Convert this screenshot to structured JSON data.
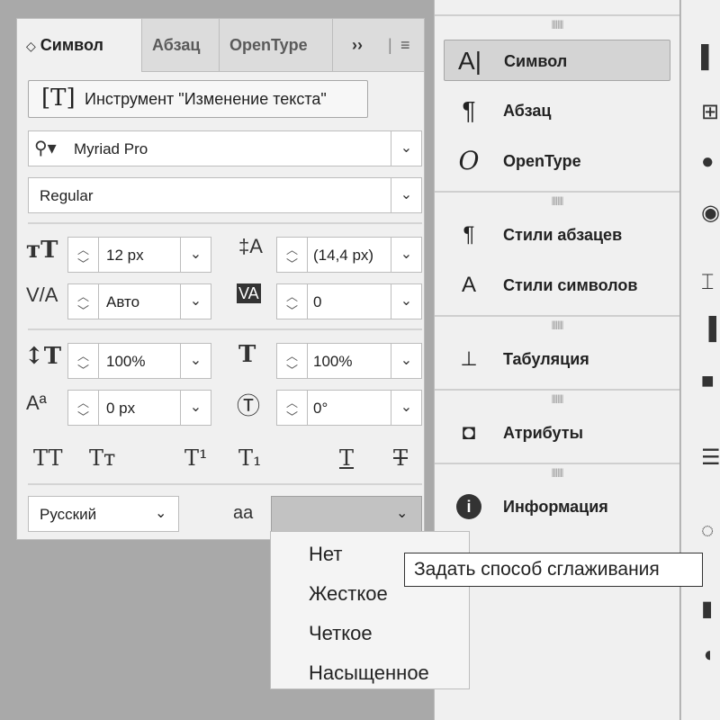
{
  "char_panel": {
    "tabs": [
      "Символ",
      "Абзац",
      "OpenType"
    ],
    "active_tab_marker": "◇",
    "more_icon": "››",
    "menu_icon": "≡",
    "tool_button_label": "Инструмент \"Изменение текста\"",
    "font_family": "Myriad Pro",
    "font_style": "Regular",
    "font_size": "12 px",
    "leading": "(14,4 px)",
    "kerning": "Авто",
    "tracking": "0",
    "vertical_scale": "100%",
    "horizontal_scale": "100%",
    "baseline_shift": "0 px",
    "rotation": "0°",
    "language": "Русский",
    "antialias_label": "aa",
    "caps_buttons": [
      "TT",
      "Tт",
      "T¹",
      "T₁",
      "T",
      "T"
    ]
  },
  "aa_menu": {
    "items": [
      "Нет",
      "Жесткое",
      "Четкое",
      "Насыщенное"
    ]
  },
  "tooltip": "Задать способ сглаживания",
  "panels": [
    {
      "label": "Символ",
      "icon": "A|"
    },
    {
      "label": "Абзац",
      "icon": "¶"
    },
    {
      "label": "OpenType",
      "icon": "O"
    },
    {
      "label": "Стили абзацев",
      "icon": "¶"
    },
    {
      "label": "Стили символов",
      "icon": "A"
    },
    {
      "label": "Табуляция",
      "icon": "⊥"
    },
    {
      "label": "Атрибуты",
      "icon": "◘"
    },
    {
      "label": "Информация",
      "icon": "i"
    }
  ]
}
